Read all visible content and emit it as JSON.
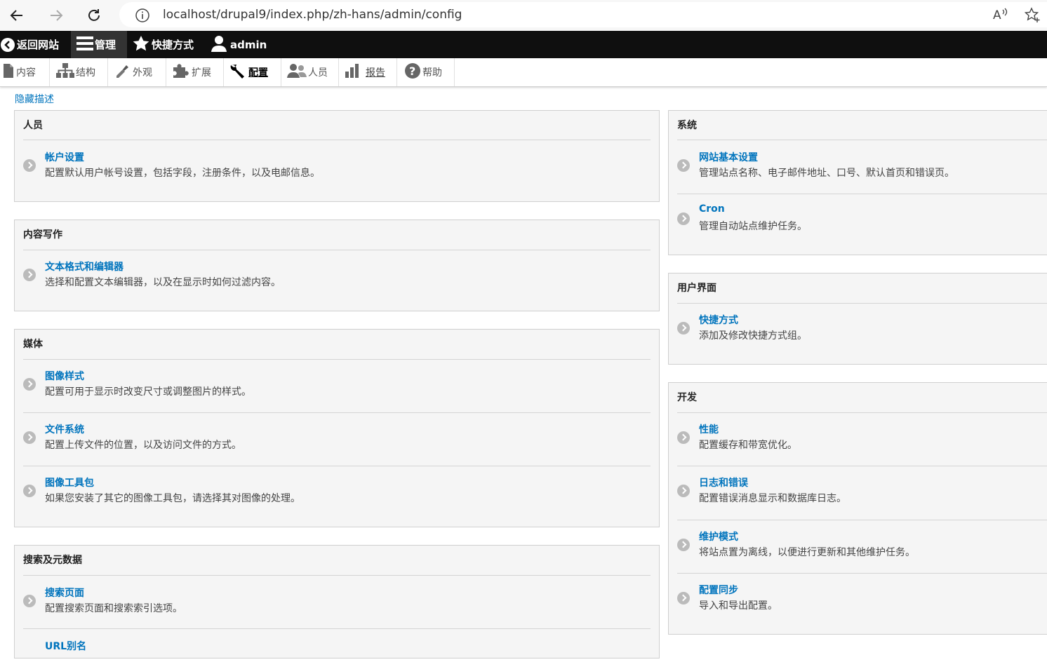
{
  "browser": {
    "url": "localhost/drupal9/index.php/zh-hans/admin/config",
    "read_aloud": "Aᴬ"
  },
  "toolbar": {
    "back_to_site": "返回网站",
    "manage": "管理",
    "shortcuts": "快捷方式",
    "user": "admin"
  },
  "tray": {
    "items": [
      {
        "label": "内容",
        "icon": "file-icon"
      },
      {
        "label": "结构",
        "icon": "sitemap-icon"
      },
      {
        "label": "外观",
        "icon": "paintbrush-icon"
      },
      {
        "label": "扩展",
        "icon": "puzzle-icon"
      },
      {
        "label": "配置",
        "icon": "wrench-icon"
      },
      {
        "label": "人员",
        "icon": "people-icon"
      },
      {
        "label": "报告",
        "icon": "bar-chart-icon"
      },
      {
        "label": "帮助",
        "icon": "help-icon"
      }
    ]
  },
  "hide_description": "隐藏描述",
  "left": [
    {
      "title": "人员",
      "entries": [
        {
          "title": "帐户设置",
          "desc": "配置默认用户帐号设置，包括字段，注册条件，以及电邮信息。"
        }
      ]
    },
    {
      "title": "内容写作",
      "entries": [
        {
          "title": "文本格式和编辑器",
          "desc": "选择和配置文本编辑器，以及在显示时如何过滤内容。"
        }
      ]
    },
    {
      "title": "媒体",
      "entries": [
        {
          "title": "图像样式",
          "desc": "配置可用于显示时改变尺寸或调整图片的样式。"
        },
        {
          "title": "文件系统",
          "desc": "配置上传文件的位置，以及访问文件的方式。"
        },
        {
          "title": "图像工具包",
          "desc": "如果您安装了其它的图像工具包，请选择其对图像的处理。"
        }
      ]
    },
    {
      "title": "搜索及元数据",
      "entries": [
        {
          "title": "搜索页面",
          "desc": "配置搜索页面和搜索索引选项。"
        },
        {
          "title": "URL别名",
          "desc": ""
        }
      ]
    }
  ],
  "right": [
    {
      "title": "系统",
      "entries": [
        {
          "title": "网站基本设置",
          "desc": "管理站点名称、电子邮件地址、口号、默认首页和错误页。"
        },
        {
          "title": "Cron",
          "desc": "管理自动站点维护任务。"
        }
      ]
    },
    {
      "title": "用户界面",
      "entries": [
        {
          "title": "快捷方式",
          "desc": "添加及修改快捷方式组。"
        }
      ]
    },
    {
      "title": "开发",
      "entries": [
        {
          "title": "性能",
          "desc": "配置缓存和带宽优化。"
        },
        {
          "title": "日志和错误",
          "desc": "配置错误消息显示和数据库日志。"
        },
        {
          "title": "维护模式",
          "desc": "将站点置为离线，以便进行更新和其他维护任务。"
        },
        {
          "title": "配置同步",
          "desc": "导入和导出配置。"
        }
      ]
    }
  ]
}
